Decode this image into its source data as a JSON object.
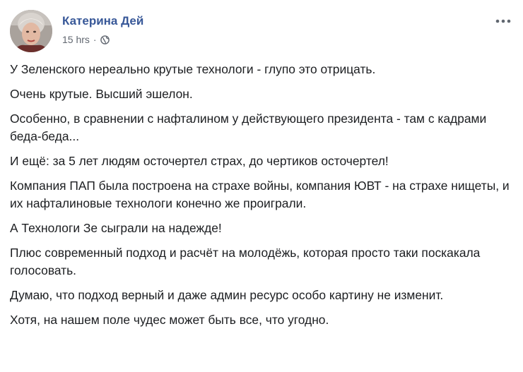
{
  "post": {
    "author": "Катерина Дей",
    "timestamp": "15 hrs",
    "separator": "·",
    "privacy_icon": "globe-icon",
    "menu_icon": "more-options-icon",
    "paragraphs": [
      "У Зеленского нереально крутые технологи - глупо это отрицать.",
      "Очень крутые. Высший эшелон.",
      "Особенно, в сравнении с нафталином у действующего президента - там с кадрами беда-беда...",
      "И ещё: за 5 лет людям осточертел страх, до чертиков осточертел!",
      "Компания ПАП была построена на страхе войны, компания ЮВТ - на страхе нищеты, и их нафталиновые технологи конечно же проиграли.",
      "А Технологи Зе сыграли на надежде!",
      "Плюс современный подход и расчёт на молодёжь, которая просто таки поскакала голосовать.",
      "Думаю, что подход верный и даже админ ресурс особо картину не изменит.",
      "Хотя, на нашем поле чудес может быть все, что угодно."
    ]
  },
  "colors": {
    "author_link": "#385898",
    "meta_text": "#616770",
    "body_text": "#1c1e21"
  }
}
